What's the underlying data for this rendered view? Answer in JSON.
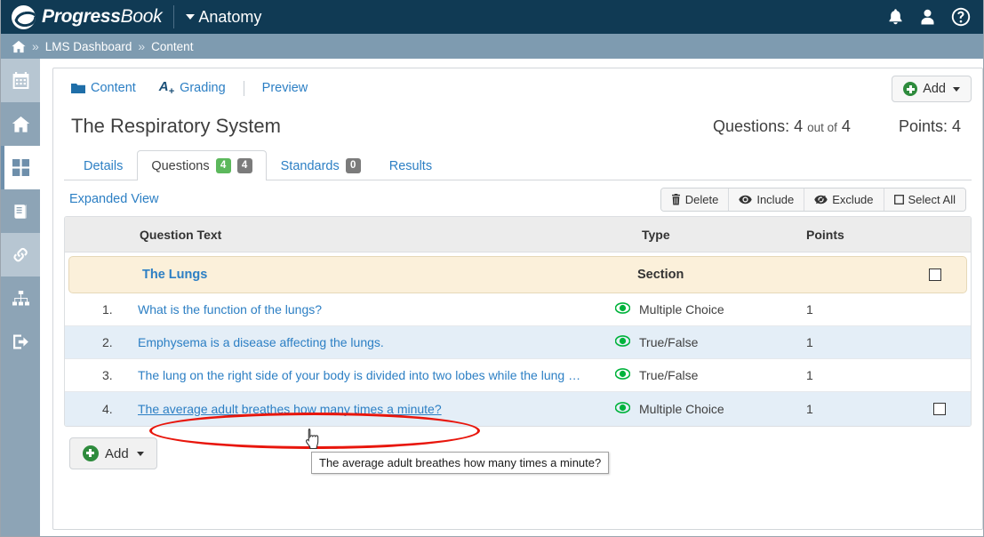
{
  "header": {
    "brand_primary": "Progress",
    "brand_secondary": "Book",
    "course_name": "Anatomy",
    "icons": [
      "bell-icon",
      "user-icon",
      "help-icon"
    ]
  },
  "breadcrumb": {
    "home": "home-icon",
    "sep": "»",
    "items": [
      "LMS Dashboard",
      "Content"
    ]
  },
  "sidebar": {
    "items": [
      {
        "name": "calendar",
        "label": "Calendar"
      },
      {
        "name": "home",
        "label": "Home"
      },
      {
        "name": "dashboard",
        "label": "Dashboard"
      },
      {
        "name": "gradebook",
        "label": "Gradebook"
      },
      {
        "name": "links",
        "label": "Links"
      },
      {
        "name": "organization",
        "label": "Organization"
      },
      {
        "name": "logout",
        "label": "Log Out"
      }
    ]
  },
  "minitabs": {
    "content": "Content",
    "grading": "Grading",
    "preview": "Preview"
  },
  "page": {
    "title": "The Respiratory System",
    "questions_label": "Questions:",
    "questions_count": "4",
    "out_of_label": "out of",
    "questions_total": "4",
    "points_label": "Points:",
    "points_value": "4",
    "add_top_label": "Add"
  },
  "tabs": [
    {
      "label": "Details",
      "active": false
    },
    {
      "label": "Questions",
      "active": true,
      "badge_green": "4",
      "badge_gray": "4"
    },
    {
      "label": "Standards",
      "active": false,
      "badge_gray": "0"
    },
    {
      "label": "Results",
      "active": false
    }
  ],
  "toolbar": {
    "expanded_view": "Expanded View",
    "delete_label": "Delete",
    "include_label": "Include",
    "exclude_label": "Exclude",
    "select_all_label": "Select All"
  },
  "table": {
    "columns": {
      "question_text": "Question Text",
      "type": "Type",
      "points": "Points"
    },
    "section": {
      "name": "The Lungs",
      "kind": "Section",
      "checked": false
    },
    "rows": [
      {
        "num": "1.",
        "text": "What is the function of the lungs?",
        "type": "Multiple Choice",
        "points": "1",
        "included": true,
        "alt": false,
        "hovered": false,
        "checkbox": false
      },
      {
        "num": "2.",
        "text": "Emphysema is a disease affecting the lungs.",
        "type": "True/False",
        "points": "1",
        "included": true,
        "alt": true,
        "hovered": false,
        "checkbox": false
      },
      {
        "num": "3.",
        "text": "The lung on the right side of your body is divided into two lobes while the lung …",
        "type": "True/False",
        "points": "1",
        "included": true,
        "alt": false,
        "hovered": false,
        "checkbox": false
      },
      {
        "num": "4.",
        "text": "The average adult breathes how many times a minute?",
        "type": "Multiple Choice",
        "points": "1",
        "included": true,
        "alt": true,
        "hovered": true,
        "checkbox": true
      }
    ]
  },
  "footer": {
    "add_label": "Add"
  },
  "annotation": {
    "tooltip_text": "The average adult breathes how many times a minute?",
    "highlight_color": "#e8160c"
  },
  "colors": {
    "topbar": "#103a54",
    "breadcrumb": "#7e9bb0",
    "rail": "#8da4b6",
    "link": "#2c7fc4",
    "green_badge": "#5cb85c",
    "gray_badge": "#7b7b7b",
    "section_row": "#fbf0da",
    "alt_row": "#e4eef7",
    "include_eye": "#00b33c"
  }
}
